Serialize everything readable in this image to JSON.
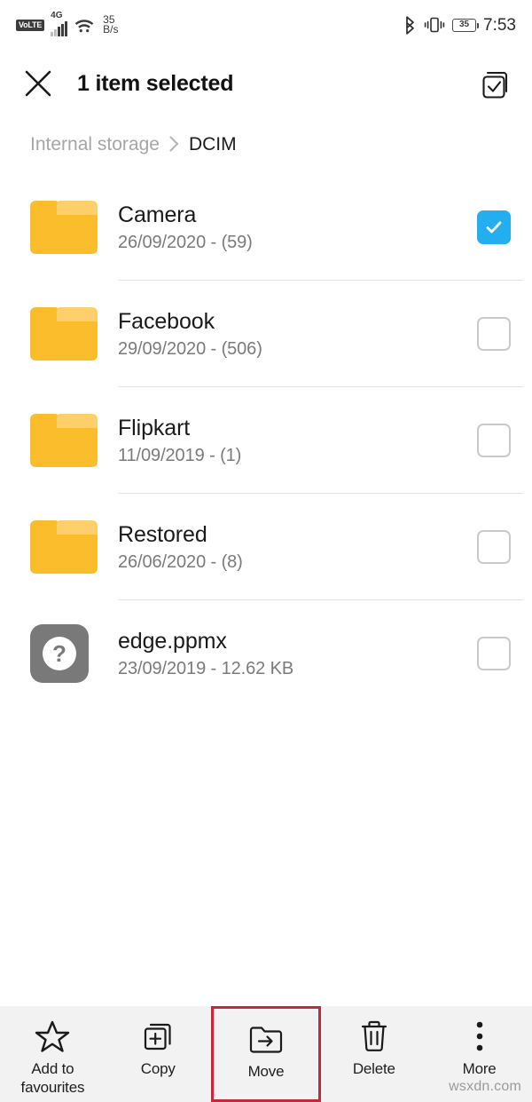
{
  "status_bar": {
    "volte_label": "VoLTE",
    "network_type": "4G",
    "signal_bars": 4,
    "wifi_icon": "wifi-icon",
    "data_speed_value": "35",
    "data_speed_unit": "B/s",
    "bluetooth_icon": "bluetooth-icon",
    "vibrate_icon": "vibrate-icon",
    "battery_level": "35",
    "clock": "7:53"
  },
  "app_bar": {
    "close_icon": "close-icon",
    "title": "1 item selected",
    "select_all_icon": "select-all-icon"
  },
  "breadcrumb": {
    "root": "Internal storage",
    "separator": "›",
    "current": "DCIM"
  },
  "files": [
    {
      "name": "Camera",
      "meta": "26/09/2020 - (59)",
      "icon": "folder-icon",
      "selected": true
    },
    {
      "name": "Facebook",
      "meta": "29/09/2020 - (506)",
      "icon": "folder-icon",
      "selected": false
    },
    {
      "name": "Flipkart",
      "meta": "11/09/2019 - (1)",
      "icon": "folder-icon",
      "selected": false
    },
    {
      "name": "Restored",
      "meta": "26/06/2020 - (8)",
      "icon": "folder-icon",
      "selected": false
    },
    {
      "name": "edge.ppmx",
      "meta": "23/09/2019 - 12.62 KB",
      "icon": "unknown-file-icon",
      "selected": false
    }
  ],
  "toolbar": {
    "add_to_favourites_label": "Add to\nfavourites",
    "add_to_favourites_line1": "Add to",
    "add_to_favourites_line2": "favourites",
    "copy_label": "Copy",
    "move_label": "Move",
    "delete_label": "Delete",
    "more_label": "More",
    "highlighted_item": "Move"
  },
  "watermark": "wsxdn.com",
  "colors": {
    "folder_amber": "#FBBD2C",
    "folder_amber_light": "#FDD06B",
    "checkbox_blue": "#22AEEF",
    "highlight_red": "#C8263C",
    "toolbar_bg": "#F2F2F2",
    "unknown_gray": "#797979"
  }
}
